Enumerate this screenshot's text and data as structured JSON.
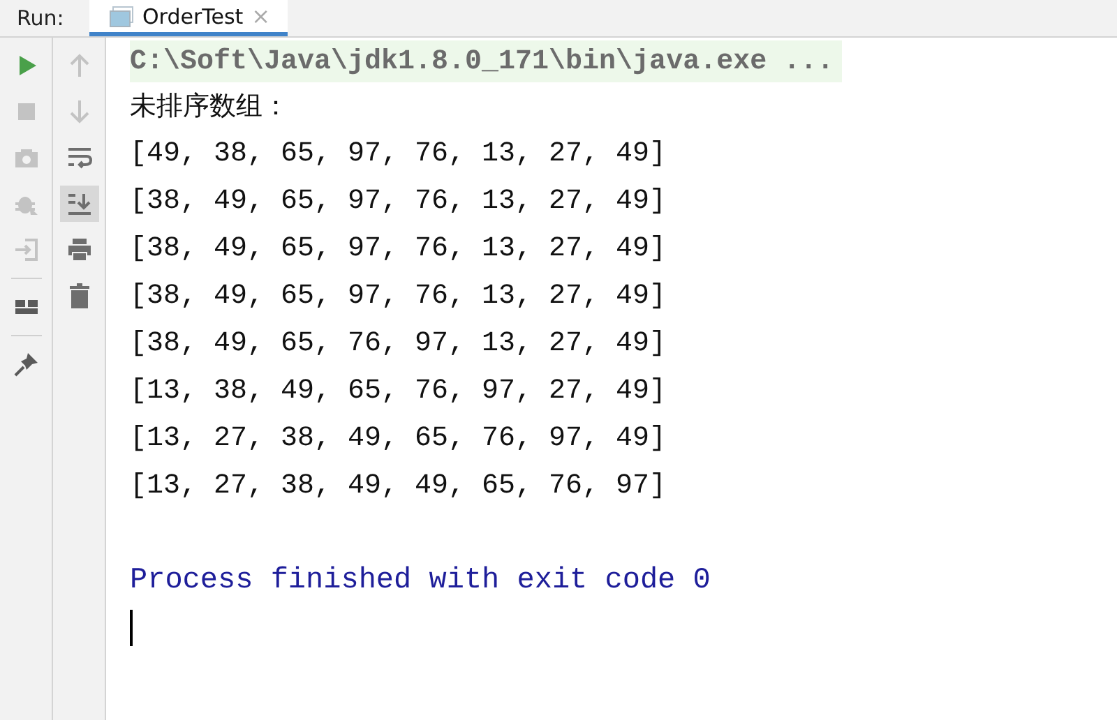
{
  "run_bar": {
    "label": "Run:",
    "tabs": [
      {
        "label": "OrderTest",
        "close": "×",
        "selected": true
      }
    ]
  },
  "left_toolbar": [
    {
      "kind": "run",
      "disabled": false
    },
    {
      "kind": "stop",
      "disabled": true
    },
    {
      "kind": "camera",
      "disabled": true
    },
    {
      "kind": "bug",
      "disabled": true
    },
    {
      "kind": "exit",
      "disabled": true
    },
    {
      "kind": "separator"
    },
    {
      "kind": "layout",
      "disabled": false
    },
    {
      "kind": "separator"
    },
    {
      "kind": "pin",
      "disabled": false
    }
  ],
  "right_toolbar": [
    {
      "kind": "up",
      "disabled": true,
      "selected": false
    },
    {
      "kind": "down",
      "disabled": true,
      "selected": false
    },
    {
      "kind": "wrap",
      "disabled": false,
      "selected": false
    },
    {
      "kind": "scroll",
      "disabled": false,
      "selected": true
    },
    {
      "kind": "print",
      "disabled": false,
      "selected": false
    },
    {
      "kind": "trash",
      "disabled": false,
      "selected": false
    }
  ],
  "console": {
    "lines": [
      {
        "kind": "command",
        "text": "C:\\Soft\\Java\\jdk1.8.0_171\\bin\\java.exe ..."
      },
      {
        "kind": "cjk",
        "text": "未排序数组："
      },
      {
        "kind": "output",
        "text": "[49, 38, 65, 97, 76, 13, 27, 49]"
      },
      {
        "kind": "output",
        "text": "[38, 49, 65, 97, 76, 13, 27, 49]"
      },
      {
        "kind": "output",
        "text": "[38, 49, 65, 97, 76, 13, 27, 49]"
      },
      {
        "kind": "output",
        "text": "[38, 49, 65, 97, 76, 13, 27, 49]"
      },
      {
        "kind": "output",
        "text": "[38, 49, 65, 76, 97, 13, 27, 49]"
      },
      {
        "kind": "output",
        "text": "[13, 38, 49, 65, 76, 97, 27, 49]"
      },
      {
        "kind": "output",
        "text": "[13, 27, 38, 49, 65, 76, 97, 49]"
      },
      {
        "kind": "output",
        "text": "[13, 27, 38, 49, 49, 65, 76, 97]"
      },
      {
        "kind": "blank"
      },
      {
        "kind": "exit",
        "text": "Process finished with exit code 0"
      }
    ],
    "caret": true
  }
}
